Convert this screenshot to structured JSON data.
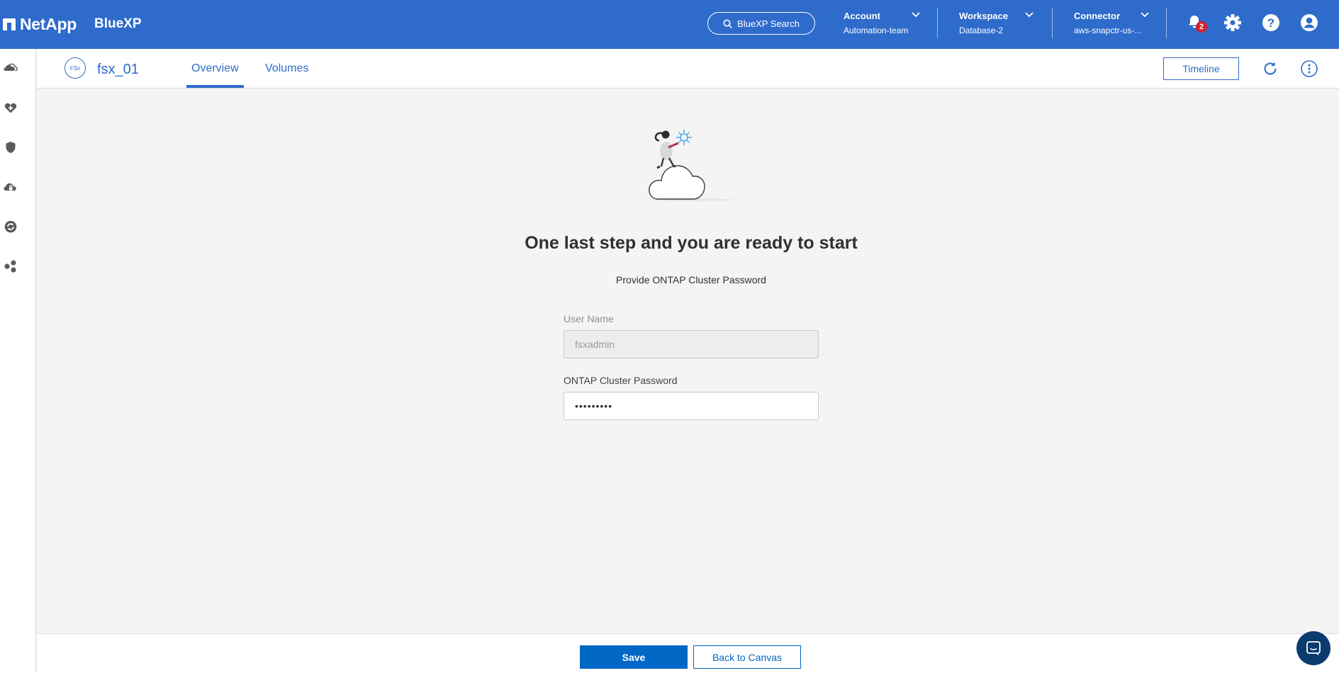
{
  "topbar": {
    "brand": "NetApp",
    "product": "BlueXP",
    "search_label": "BlueXP Search",
    "account": {
      "label": "Account",
      "value": "Automation-team"
    },
    "workspace": {
      "label": "Workspace",
      "value": "Database-2"
    },
    "connector": {
      "label": "Connector",
      "value": "aws-snapctr-us-..."
    },
    "notifications_count": "2",
    "bg_color": "#2e6bcb"
  },
  "sidebar": {
    "icons": [
      "storage-icon",
      "health-icon",
      "protection-icon",
      "governance-icon",
      "mobility-icon",
      "extensions-icon"
    ]
  },
  "subheader": {
    "env_icon_text": "FSx",
    "env_name": "fsx_01",
    "tabs": [
      {
        "label": "Overview",
        "active": true
      },
      {
        "label": "Volumes",
        "active": false
      }
    ],
    "timeline_label": "Timeline"
  },
  "main": {
    "heading": "One last step and you are ready to start",
    "subheading": "Provide ONTAP Cluster Password",
    "username_label": "User Name",
    "username_value": "fsxadmin",
    "password_label": "ONTAP Cluster Password",
    "password_value": "•••••••••"
  },
  "footer": {
    "save_label": "Save",
    "back_label": "Back to Canvas"
  },
  "colors": {
    "accent": "#2e6bcb",
    "primary_button": "#0067c5",
    "badge": "#d61f2b"
  }
}
